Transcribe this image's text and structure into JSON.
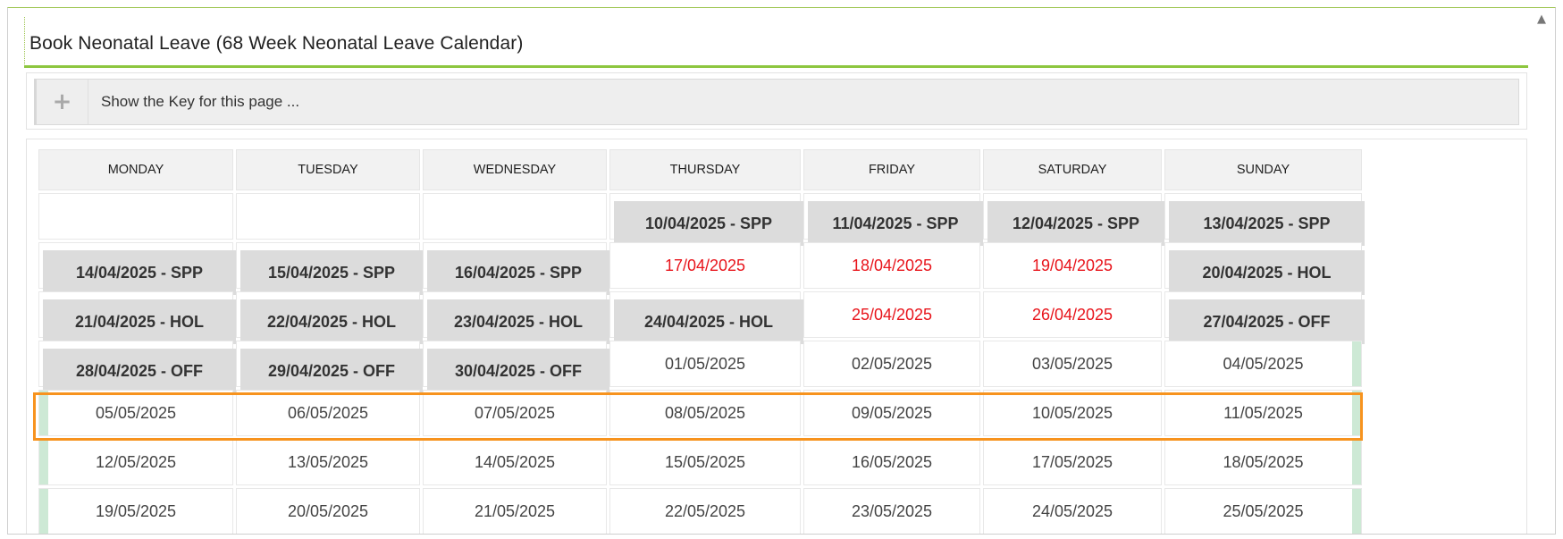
{
  "page": {
    "title": "Book Neonatal Leave (68 Week Neonatal Leave Calendar)",
    "scroll_icon": "scroll-up-arrow-icon"
  },
  "key_panel": {
    "toggle_symbol": "+",
    "label": "Show the Key for this page ..."
  },
  "calendar": {
    "days": [
      "MONDAY",
      "TUESDAY",
      "WEDNESDAY",
      "THURSDAY",
      "FRIDAY",
      "SATURDAY",
      "SUNDAY"
    ],
    "highlighted_week_index": 5,
    "colors": {
      "booked_bg": "#dcdcdc",
      "booked_edge": "#cde9d5",
      "bank_holiday_text": "#e8141b",
      "highlight_border": "#f7931e",
      "title_rule": "#8dc63f"
    },
    "weeks": [
      [
        {
          "text": "",
          "kind": "empty"
        },
        {
          "text": "",
          "kind": "empty"
        },
        {
          "text": "",
          "kind": "empty"
        },
        {
          "text": "10/04/2025 - SPP",
          "kind": "booked"
        },
        {
          "text": "11/04/2025 - SPP",
          "kind": "booked"
        },
        {
          "text": "12/04/2025 - SPP",
          "kind": "booked"
        },
        {
          "text": "13/04/2025 - SPP",
          "kind": "booked"
        }
      ],
      [
        {
          "text": "14/04/2025 - SPP",
          "kind": "booked"
        },
        {
          "text": "15/04/2025 - SPP",
          "kind": "booked"
        },
        {
          "text": "16/04/2025 - SPP",
          "kind": "booked"
        },
        {
          "text": "17/04/2025",
          "kind": "bank"
        },
        {
          "text": "18/04/2025",
          "kind": "bank"
        },
        {
          "text": "19/04/2025",
          "kind": "bank"
        },
        {
          "text": "20/04/2025 - HOL",
          "kind": "booked"
        }
      ],
      [
        {
          "text": "21/04/2025 - HOL",
          "kind": "booked"
        },
        {
          "text": "22/04/2025 - HOL",
          "kind": "booked"
        },
        {
          "text": "23/04/2025 - HOL",
          "kind": "booked"
        },
        {
          "text": "24/04/2025 - HOL",
          "kind": "booked"
        },
        {
          "text": "25/04/2025",
          "kind": "bank"
        },
        {
          "text": "26/04/2025",
          "kind": "bank"
        },
        {
          "text": "27/04/2025 - OFF",
          "kind": "booked"
        }
      ],
      [
        {
          "text": "28/04/2025 - OFF",
          "kind": "booked"
        },
        {
          "text": "29/04/2025 - OFF",
          "kind": "booked"
        },
        {
          "text": "30/04/2025 - OFF",
          "kind": "booked"
        },
        {
          "text": "01/05/2025",
          "kind": "plain"
        },
        {
          "text": "02/05/2025",
          "kind": "plain"
        },
        {
          "text": "03/05/2025",
          "kind": "plain"
        },
        {
          "text": "04/05/2025",
          "kind": "plain"
        }
      ],
      [
        {
          "text": "05/05/2025",
          "kind": "plain"
        },
        {
          "text": "06/05/2025",
          "kind": "plain"
        },
        {
          "text": "07/05/2025",
          "kind": "plain"
        },
        {
          "text": "08/05/2025",
          "kind": "plain"
        },
        {
          "text": "09/05/2025",
          "kind": "plain"
        },
        {
          "text": "10/05/2025",
          "kind": "plain"
        },
        {
          "text": "11/05/2025",
          "kind": "plain"
        }
      ],
      [
        {
          "text": "12/05/2025",
          "kind": "plain"
        },
        {
          "text": "13/05/2025",
          "kind": "plain"
        },
        {
          "text": "14/05/2025",
          "kind": "plain"
        },
        {
          "text": "15/05/2025",
          "kind": "plain"
        },
        {
          "text": "16/05/2025",
          "kind": "plain"
        },
        {
          "text": "17/05/2025",
          "kind": "plain"
        },
        {
          "text": "18/05/2025",
          "kind": "plain"
        }
      ],
      [
        {
          "text": "19/05/2025",
          "kind": "plain"
        },
        {
          "text": "20/05/2025",
          "kind": "plain"
        },
        {
          "text": "21/05/2025",
          "kind": "plain"
        },
        {
          "text": "22/05/2025",
          "kind": "plain"
        },
        {
          "text": "23/05/2025",
          "kind": "plain"
        },
        {
          "text": "24/05/2025",
          "kind": "plain"
        },
        {
          "text": "25/05/2025",
          "kind": "plain"
        }
      ]
    ]
  }
}
